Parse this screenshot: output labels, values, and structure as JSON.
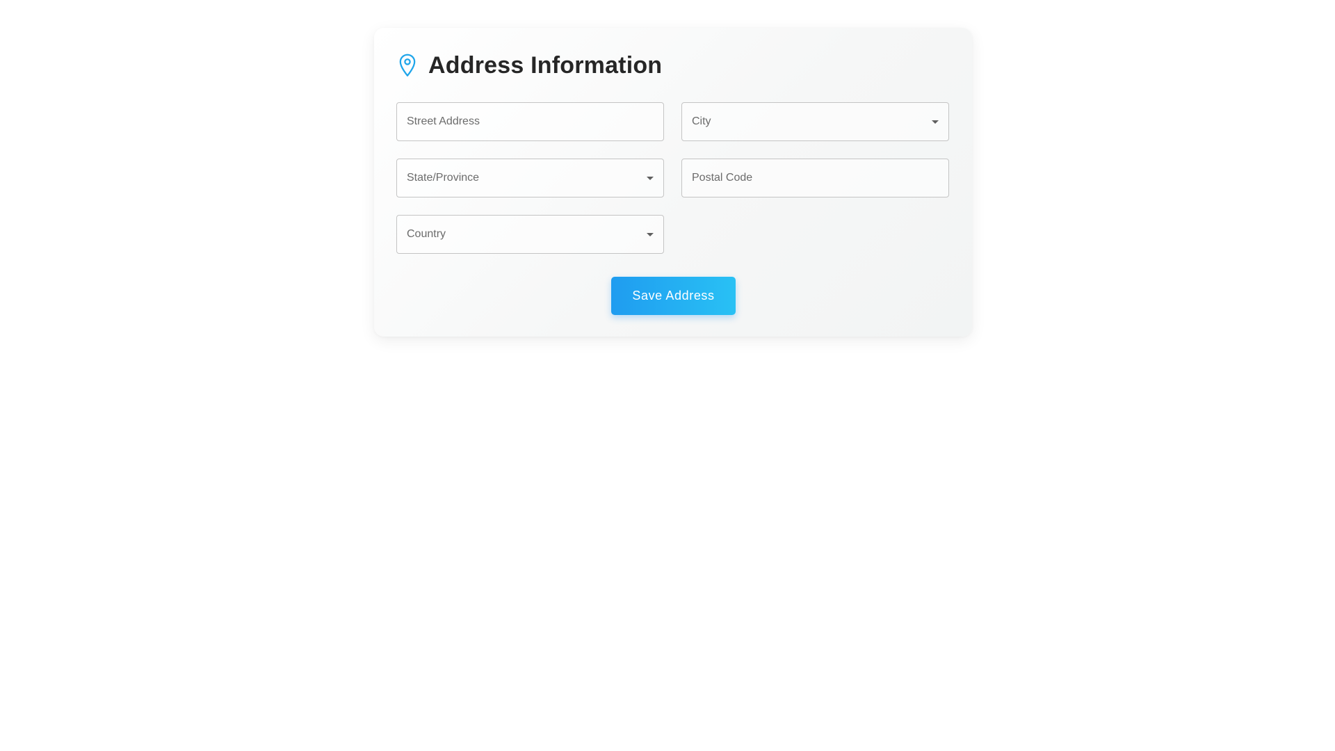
{
  "header": {
    "icon": "map-pin-icon",
    "title": "Address Information",
    "accent_color": "#1ea5ea"
  },
  "form": {
    "street_address": {
      "placeholder": "Street Address",
      "value": ""
    },
    "city": {
      "placeholder": "City",
      "value": "",
      "type": "select"
    },
    "state_province": {
      "placeholder": "State/Province",
      "value": "",
      "type": "select"
    },
    "postal_code": {
      "placeholder": "Postal Code",
      "value": ""
    },
    "country": {
      "placeholder": "Country",
      "value": "",
      "type": "select"
    }
  },
  "actions": {
    "save_label": "Save Address",
    "save_color_start": "#1f9cf0",
    "save_color_end": "#29c1f4"
  }
}
